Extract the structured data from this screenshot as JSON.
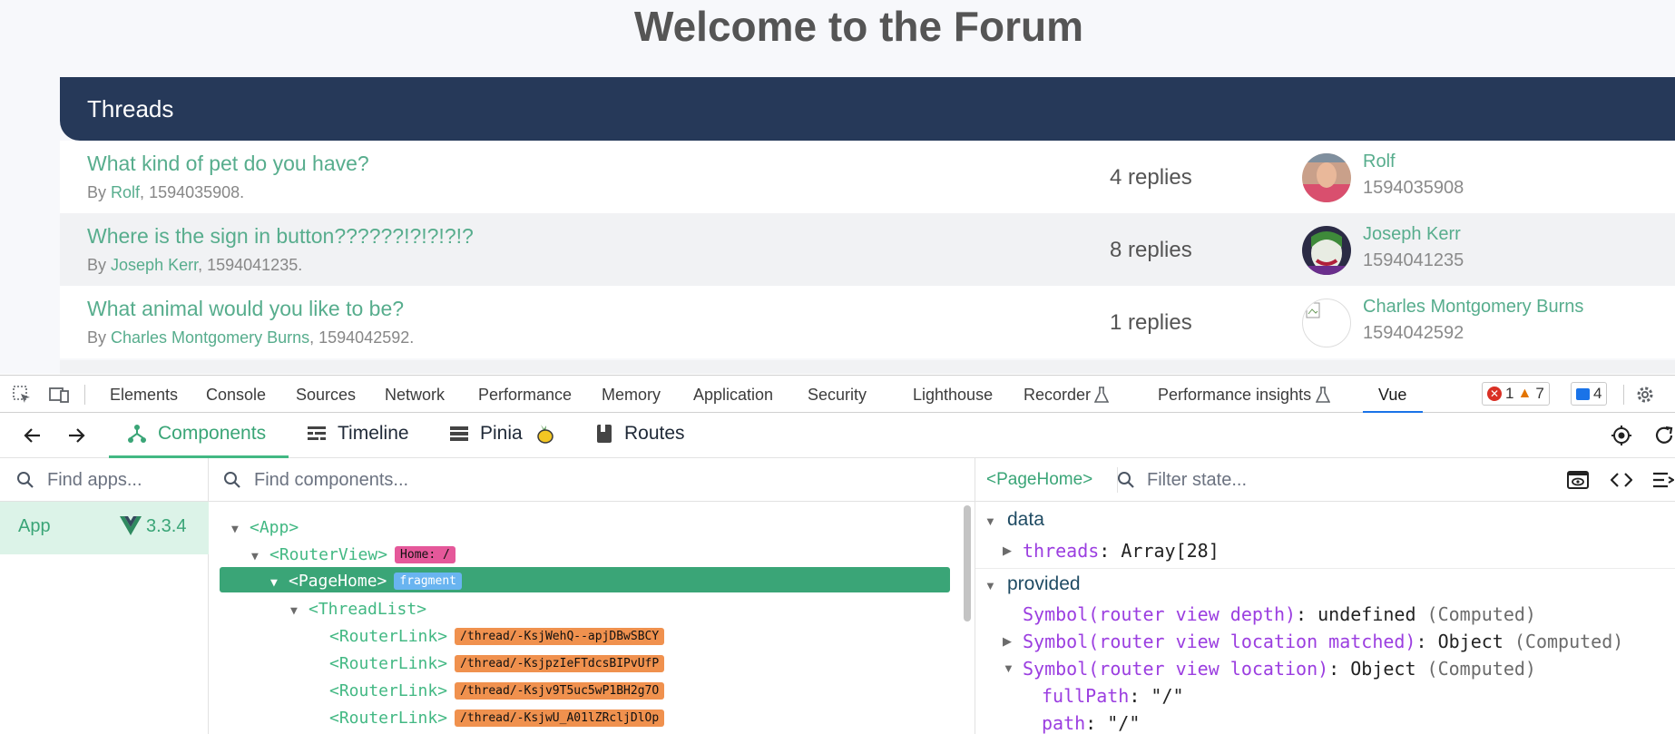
{
  "forum": {
    "title": "Welcome to the Forum",
    "threads_header": "Threads",
    "threads": [
      {
        "title": "What kind of pet do you have?",
        "by": "By",
        "author": "Rolf",
        "timestamp": "1594035908.",
        "replies": "4 replies",
        "last_user": "Rolf",
        "last_ts": "1594035908"
      },
      {
        "title": "Where is the sign in button??????!?!?!?!?",
        "by": "By",
        "author": "Joseph Kerr",
        "timestamp": "1594041235.",
        "replies": "8 replies",
        "last_user": "Joseph Kerr",
        "last_ts": "1594041235"
      },
      {
        "title": "What animal would you like to be?",
        "by": "By",
        "author": "Charles Montgomery Burns",
        "timestamp": "1594042592.",
        "replies": "1 replies",
        "last_user": "Charles Montgomery Burns",
        "last_ts": "1594042592"
      }
    ]
  },
  "devtools": {
    "tabs": [
      "Elements",
      "Console",
      "Sources",
      "Network",
      "Performance",
      "Memory",
      "Application",
      "Security",
      "Lighthouse",
      "Recorder",
      "Performance insights",
      "Vue"
    ],
    "active_tab": "Vue",
    "errors": "1",
    "warnings": "7",
    "messages": "4"
  },
  "vue": {
    "tabs": {
      "components": "Components",
      "timeline": "Timeline",
      "pinia": "Pinia",
      "routes": "Routes"
    },
    "apps_placeholder": "Find apps...",
    "app_name": "App",
    "app_version": "3.3.4",
    "components_placeholder": "Find components...",
    "tree": {
      "app": "<App>",
      "router_view": "<RouterView>",
      "router_view_tag": "Home: /",
      "page_home": "<PageHome>",
      "page_home_tag": "fragment",
      "thread_list": "<ThreadList>",
      "router_links": [
        {
          "name": "<RouterLink>",
          "tag": "/thread/-KsjWehQ--apjDBwSBCY"
        },
        {
          "name": "<RouterLink>",
          "tag": "/thread/-KsjpzIeFTdcsBIPvUfP"
        },
        {
          "name": "<RouterLink>",
          "tag": "/thread/-Ksjv9T5uc5wP1BH2g7O"
        },
        {
          "name": "<RouterLink>",
          "tag": "/thread/-KsjwU_A01lZRcljDlOp"
        }
      ]
    },
    "state": {
      "selected": "<PageHome>",
      "filter_placeholder": "Filter state...",
      "data_label": "data",
      "threads_key": "threads",
      "threads_val": "Array[28]",
      "provided_label": "provided",
      "entries": [
        {
          "key": "Symbol(router view depth)",
          "val": "undefined",
          "note": "(Computed)"
        },
        {
          "key": "Symbol(router view location matched)",
          "val": "Object",
          "note": "(Computed)"
        },
        {
          "key": "Symbol(router view location)",
          "val": "Object",
          "note": "(Computed)"
        }
      ],
      "full_path_key": "fullPath",
      "full_path_val": "\"/\"",
      "path_key": "path",
      "path_val": "\"/\""
    }
  },
  "colors": {
    "accent": "#42b883",
    "header": "#263959",
    "link": "#57ad8d"
  }
}
